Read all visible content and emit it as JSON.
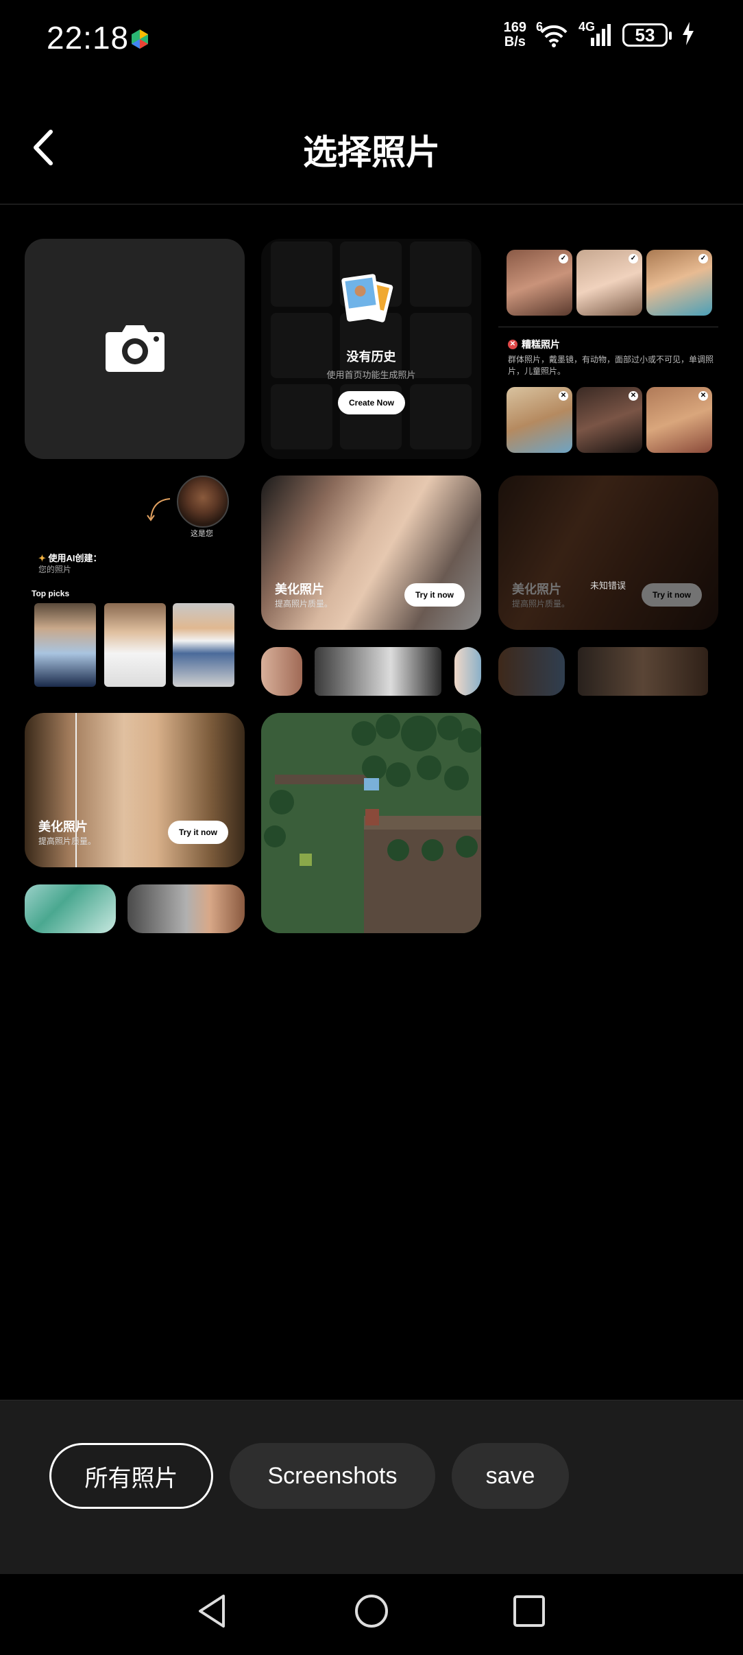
{
  "status_bar": {
    "time": "22:18",
    "net_speed_value": "169",
    "net_speed_unit": "B/s",
    "wifi_badge": "6",
    "cell_label": "4G",
    "battery": "53",
    "icons": [
      "play-store-icon",
      "wifi-icon",
      "signal-icon",
      "battery-icon",
      "charging-icon"
    ]
  },
  "header": {
    "title": "选择照片",
    "back_icon": "chevron-left-icon"
  },
  "grid": {
    "camera_icon": "camera-icon",
    "history": {
      "title": "没有历史",
      "subtitle": "使用首页功能生成照片",
      "button": "Create Now"
    },
    "guide": {
      "bad_title": "糟糕照片",
      "bad_desc": "群体照片，戴墨镜，有动物，面部过小或不可见，单调照片，儿童照片。"
    },
    "ai_create": {
      "badge": "这是您",
      "heading": "使用AI创建：",
      "sub": "您的照片",
      "top_picks": "Top picks"
    },
    "promo": {
      "label": "美化照片",
      "sub": "提高照片质量。",
      "button": "Try it now"
    },
    "error_text": "未知错误"
  },
  "albums": {
    "items": [
      {
        "label": "所有照片",
        "active": true
      },
      {
        "label": "Screenshots",
        "active": false
      },
      {
        "label": "save",
        "active": false
      }
    ]
  },
  "navbar": {
    "icons": [
      "back-triangle-icon",
      "home-circle-icon",
      "recents-square-icon"
    ]
  }
}
